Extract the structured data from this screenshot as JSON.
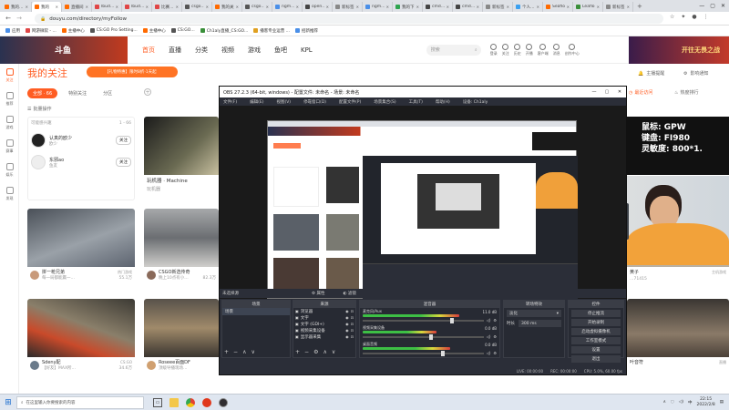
{
  "browser": {
    "tabs": [
      {
        "label": "我的…",
        "color": "#ff6a00",
        "active": false
      },
      {
        "label": "我的",
        "color": "#ff6a00",
        "active": true
      },
      {
        "label": "直播间",
        "color": "#ff6a00",
        "active": false
      },
      {
        "label": "lbud…",
        "color": "#e04646",
        "active": false
      },
      {
        "label": "lbud…",
        "color": "#e04646",
        "active": false
      },
      {
        "label": "比赛…",
        "color": "#e04646",
        "active": false
      },
      {
        "label": "csgo…",
        "color": "#555555",
        "active": false
      },
      {
        "label": "我的关注",
        "color": "#ff6a00",
        "active": false
      },
      {
        "label": "csgo…",
        "color": "#555555",
        "active": false
      },
      {
        "label": "ngm…",
        "color": "#4a8fe8",
        "active": false
      },
      {
        "label": "open…",
        "color": "#444444",
        "active": false
      },
      {
        "label": "新标签",
        "color": "#888888",
        "active": false
      },
      {
        "label": "ngm…",
        "color": "#4a8fe8",
        "active": false
      },
      {
        "label": "我的下…",
        "color": "#2ea44f",
        "active": false
      },
      {
        "label": "cmd…",
        "color": "#444444",
        "active": false
      },
      {
        "label": "cmd…",
        "color": "#444444",
        "active": false
      },
      {
        "label": "新标签",
        "color": "#888888",
        "active": false
      },
      {
        "label": "个人…",
        "color": "#3aa0f0",
        "active": false
      },
      {
        "label": "Seaflo…",
        "color": "#ff6a00",
        "active": false
      },
      {
        "label": "Leaflo…",
        "color": "#3a8f3a",
        "active": false
      },
      {
        "label": "新标签",
        "color": "#888888",
        "active": false
      }
    ],
    "url": "douyu.com/directory/myFollow",
    "bookmarks": [
      "应用",
      "网游微软 - ...",
      "主播中心",
      "CS:GO Pro Setting...",
      "主播中心",
      "CS:GO…",
      "Ch1aly直播_CS:GO...",
      "播客专业运营 ...",
      "招新推荐"
    ]
  },
  "douyu": {
    "logo": "斗鱼",
    "nav": [
      "首页",
      "直播",
      "分类",
      "视频",
      "游戏",
      "鱼吧",
      "KPL"
    ],
    "nav_active": "首页",
    "search_placeholder": "搜索",
    "header_right": [
      "登录",
      "关注",
      "历史",
      "开播",
      "客户端",
      "消息",
      "创作中心"
    ],
    "promo": "开往无畏之战",
    "sidebar": [
      {
        "label": "关注",
        "active": true
      },
      {
        "label": "推荐",
        "active": false
      },
      {
        "label": "游戏",
        "active": false
      },
      {
        "label": "赛事",
        "active": false
      },
      {
        "label": "娱乐",
        "active": false
      },
      {
        "label": "发现",
        "active": false
      }
    ],
    "page_title": "我的关注",
    "vip_banner": "【礼物特惠】限时8折·1天起",
    "filter_tabs": [
      "全部 · 66",
      "特别关注",
      "分区"
    ],
    "batch_op": "批量操作",
    "follow_list_header": "可能感兴趣",
    "follow_list_count": "1 - 66",
    "follow_items": [
      {
        "name": "认真的欧少",
        "sub": "欧少",
        "btn": "关注"
      },
      {
        "name": "东邪ao",
        "sub": "鱼友",
        "btn": "关注"
      }
    ],
    "right_top": {
      "a": "主播提醒",
      "b": "影响通知",
      "c": "最近访问",
      "d": "热度排行"
    },
    "streamer_overlay": {
      "line1": "鼠标: GPW",
      "line2": "键盘: FI980",
      "line3": "灵敏度: 800*1."
    },
    "cards": [
      {
        "title": "狗子的快乐",
        "streamer": "",
        "count": ""
      },
      {
        "title": "玩机器 · Machine",
        "streamer": "玩机器",
        "count": "回放"
      },
      {
        "title": "",
        "streamer": "",
        "count": ""
      },
      {
        "title": "拼一枪兄弟",
        "streamer": "每一局都能赢一…",
        "count": "55.1万",
        "tag": "热门游戏"
      },
      {
        "title": "CSGO新选传奇",
        "streamer": "晚上10点有小…",
        "count": "82.3万"
      },
      {
        "title": "Sdeny配",
        "streamer": "【好友】MAX所…",
        "count": "34.6万",
        "tag": "CS:GO"
      },
      {
        "title": "Roseee百面DF",
        "streamer": "顶级导播现场…",
        "count": "38.2万"
      },
      {
        "title": "黄子",
        "streamer": "…71415",
        "count": "",
        "tag": "主机游戏"
      },
      {
        "title": "叶音符",
        "streamer": "…",
        "count": "",
        "tag": "直播"
      }
    ]
  },
  "obs": {
    "title": "OBS 27.2.3 (64-bit, windows) - 配置文件: 未命名 - 场景: 未命名",
    "menu": [
      "文件(F)",
      "编辑(E)",
      "视图(V)",
      "停靠窗口(D)",
      "配置文件(P)",
      "场景集合(S)",
      "工具(T)",
      "帮助(H)",
      "设备: Ch1aly"
    ],
    "status_bar": "未选择源",
    "props_btn": "属性",
    "filters_btn": "滤镜",
    "docks": {
      "scenes": {
        "title": "场景",
        "items": [
          "场景"
        ]
      },
      "sources": {
        "title": "来源",
        "items": [
          "浏览器",
          "文字",
          "文字 (GDI+)",
          "视频采集设备",
          "显示器采集"
        ]
      },
      "mixer": {
        "title": "混音器",
        "channels": [
          {
            "name": "麦克风/Aux",
            "db": "11.0 dB",
            "level": 0.72
          },
          {
            "name": "视频采集设备",
            "db": "0.0 dB",
            "level": 0.55
          },
          {
            "name": "桌面音频",
            "db": "0.0 dB",
            "level": 0.65
          }
        ]
      },
      "transitions": {
        "title": "转场特效",
        "type": "淡化",
        "duration_label": "时长",
        "duration": "300 ms"
      },
      "controls": {
        "title": "控件",
        "buttons": [
          "停止推流",
          "开始录制",
          "启动虚拟摄像机",
          "工作室模式",
          "设置",
          "退出"
        ]
      }
    },
    "statusbar": {
      "live": "LIVE: 00:00:00",
      "rec": "REC: 00:00:00",
      "cpu": "CPU: 5.0%, 60.00 fps"
    }
  },
  "taskbar": {
    "search": "在这里输入你要搜索的内容",
    "time": "22:15",
    "date": "2022/2/8",
    "lang": "中"
  },
  "colors": {
    "accent": "#ff5d23",
    "obs_bg": "#2b2e38"
  }
}
